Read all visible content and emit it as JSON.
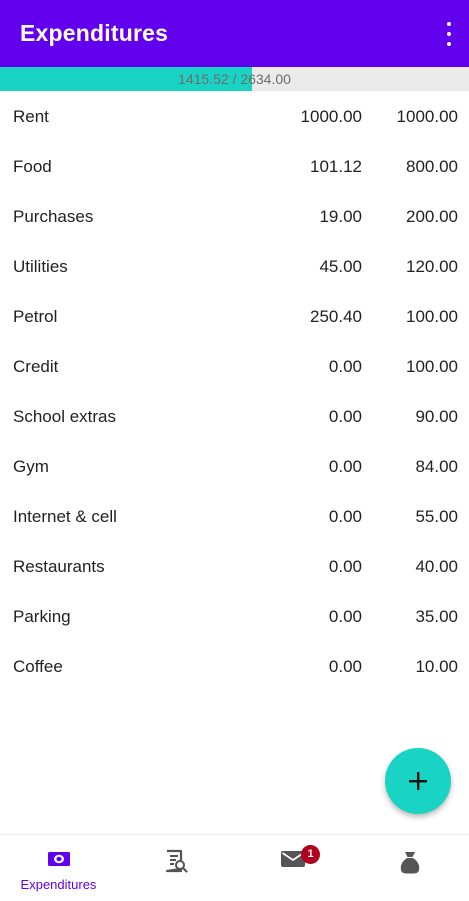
{
  "appbar": {
    "title": "Expenditures",
    "menu_icon": "more-vert-icon"
  },
  "progress": {
    "label": "1415.52 / 2634.00",
    "spent": 1415.52,
    "total": 2634.0,
    "fill_color": "#19d3c5"
  },
  "categories": [
    {
      "name": "Rent",
      "spent": "1000.00",
      "budget": "1000.00"
    },
    {
      "name": "Food",
      "spent": "101.12",
      "budget": "800.00"
    },
    {
      "name": "Purchases",
      "spent": "19.00",
      "budget": "200.00"
    },
    {
      "name": "Utilities",
      "spent": "45.00",
      "budget": "120.00"
    },
    {
      "name": "Petrol",
      "spent": "250.40",
      "budget": "100.00"
    },
    {
      "name": "Credit",
      "spent": "0.00",
      "budget": "100.00"
    },
    {
      "name": "School extras",
      "spent": "0.00",
      "budget": "90.00"
    },
    {
      "name": "Gym",
      "spent": "0.00",
      "budget": "84.00"
    },
    {
      "name": "Internet & cell",
      "spent": "0.00",
      "budget": "55.00"
    },
    {
      "name": "Restaurants",
      "spent": "0.00",
      "budget": "40.00"
    },
    {
      "name": "Parking",
      "spent": "0.00",
      "budget": "35.00"
    },
    {
      "name": "Coffee",
      "spent": "0.00",
      "budget": "10.00"
    }
  ],
  "fab": {
    "icon": "plus-icon"
  },
  "bottom_nav": {
    "items": [
      {
        "label": "Expenditures",
        "icon": "money-icon",
        "active": true
      },
      {
        "label": "",
        "icon": "receipt-search-icon",
        "active": false
      },
      {
        "label": "",
        "icon": "mail-icon",
        "active": false,
        "badge": "1"
      },
      {
        "label": "",
        "icon": "money-bag-icon",
        "active": false
      }
    ]
  },
  "colors": {
    "primary": "#6200ee",
    "accent": "#19d3c5",
    "badge": "#b00020"
  }
}
